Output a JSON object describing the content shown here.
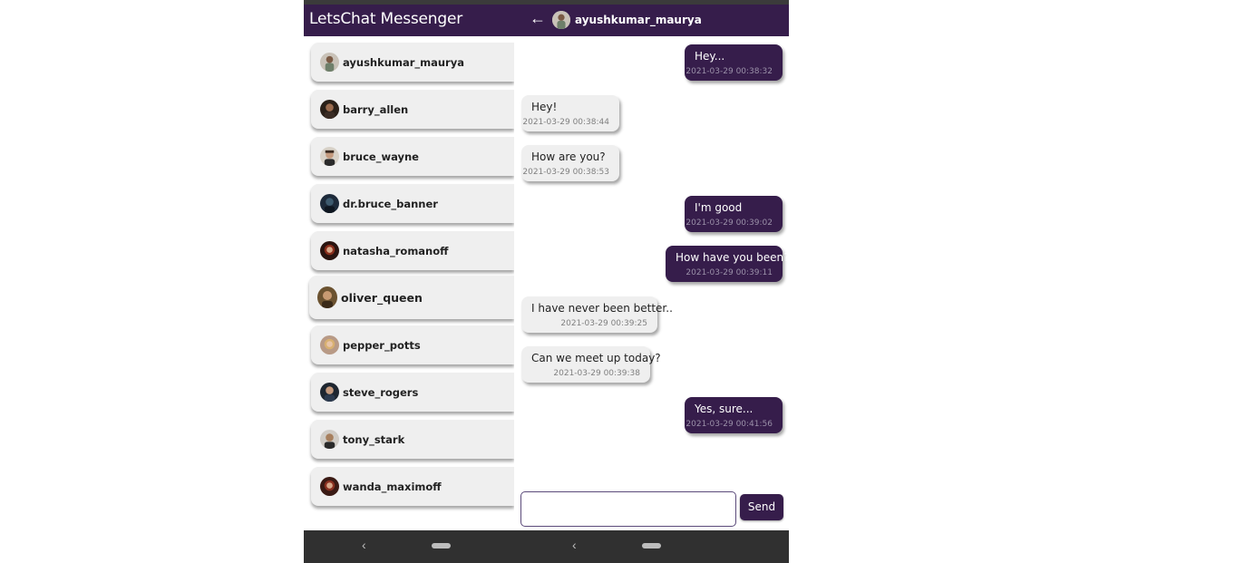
{
  "left_screen": {
    "app_title": "LetsChat Messenger",
    "contacts": [
      {
        "name": "ayushkumar_maurya",
        "avatar_color": "#c9c2b8"
      },
      {
        "name": "barry_allen",
        "avatar_color": "#2a2018"
      },
      {
        "name": "bruce_wayne",
        "avatar_color": "#a08a78"
      },
      {
        "name": "dr.bruce_banner",
        "avatar_color": "#1d2a3a"
      },
      {
        "name": "natasha_romanoff",
        "avatar_color": "#5a1e14"
      },
      {
        "name": "oliver_queen",
        "avatar_color": "#6b5230"
      },
      {
        "name": "pepper_potts",
        "avatar_color": "#b89a86"
      },
      {
        "name": "steve_rogers",
        "avatar_color": "#1e2630"
      },
      {
        "name": "tony_stark",
        "avatar_color": "#9a9590"
      },
      {
        "name": "wanda_maximoff",
        "avatar_color": "#6a2a1e"
      }
    ],
    "nav": {
      "back_icon": "‹"
    }
  },
  "right_screen": {
    "back_icon": "←",
    "contact_name": "ayushkumar_maurya",
    "messages": [
      {
        "text": "Hey...",
        "time": "2021-03-29 00:38:32",
        "direction": "sent"
      },
      {
        "text": "Hey!",
        "time": "2021-03-29 00:38:44",
        "direction": "received"
      },
      {
        "text": "How are you?",
        "time": "2021-03-29 00:38:53",
        "direction": "received"
      },
      {
        "text": "I'm good",
        "time": "2021-03-29 00:39:02",
        "direction": "sent"
      },
      {
        "text": "How have you been?",
        "time": "2021-03-29 00:39:11",
        "direction": "sent"
      },
      {
        "text": "I have never been better..",
        "time": "2021-03-29 00:39:25",
        "direction": "received"
      },
      {
        "text": "Can we meet up today?",
        "time": "2021-03-29 00:39:38",
        "direction": "received"
      },
      {
        "text": "Yes, sure...",
        "time": "2021-03-29 00:41:56",
        "direction": "sent"
      }
    ],
    "composer": {
      "value": "",
      "send_label": "Send"
    },
    "nav": {
      "back_icon": "‹"
    }
  },
  "colors": {
    "primary": "#361d4b",
    "bubble_received": "#efefef",
    "nav_bar": "#303030"
  }
}
